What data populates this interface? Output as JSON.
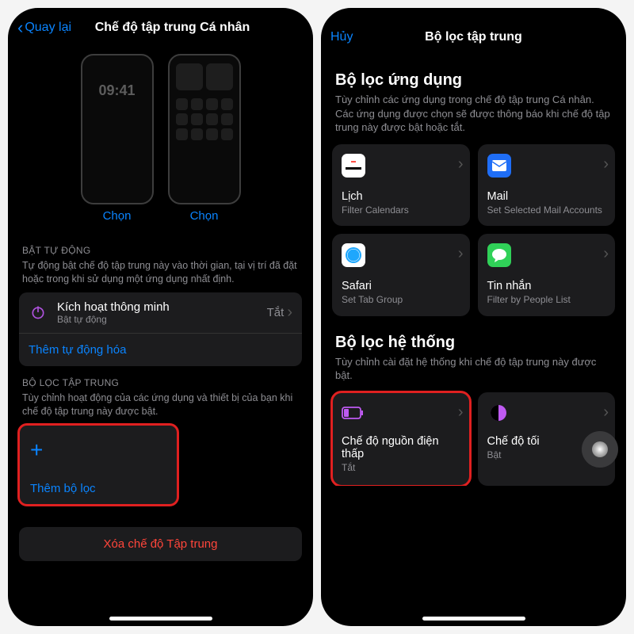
{
  "left": {
    "back": "Quay lại",
    "title": "Chế độ tập trung Cá nhân",
    "lock_time": "09:41",
    "choose": "Chọn",
    "auto_on_header": "BẬT TỰ ĐỘNG",
    "auto_on_desc": "Tự động bật chế độ tập trung này vào thời gian, tại vị trí đã đặt hoặc trong khi sử dụng một ứng dụng nhất định.",
    "smart_row": {
      "title": "Kích hoạt thông minh",
      "sub": "Bật tự động",
      "status": "Tắt"
    },
    "add_automation": "Thêm tự động hóa",
    "filters_header": "BỘ LỌC TẬP TRUNG",
    "filters_desc": "Tùy chỉnh hoạt động của các ứng dụng và thiết bị của bạn khi chế độ tập trung này được bật.",
    "add_filter": "Thêm bộ lọc",
    "delete": "Xóa chế độ Tập trung"
  },
  "right": {
    "cancel": "Hủy",
    "title": "Bộ lọc tập trung",
    "app_section": {
      "title": "Bộ lọc ứng dụng",
      "desc": "Tùy chỉnh các ứng dụng trong chế độ tập trung Cá nhân. Các ứng dụng được chọn sẽ được thông báo khi chế độ tập trung này được bật hoặc tắt."
    },
    "tiles": {
      "calendar": {
        "title": "Lịch",
        "sub": "Filter Calendars"
      },
      "mail": {
        "title": "Mail",
        "sub": "Set Selected Mail Accounts"
      },
      "safari": {
        "title": "Safari",
        "sub": "Set Tab Group"
      },
      "messages": {
        "title": "Tin nhắn",
        "sub": "Filter by People List"
      }
    },
    "sys_section": {
      "title": "Bộ lọc hệ thống",
      "desc": "Tùy chỉnh cài đặt hệ thống khi chế độ tập trung này được bật."
    },
    "sys_tiles": {
      "low_power": {
        "title": "Chế độ nguồn điện thấp",
        "status": "Tắt"
      },
      "dark": {
        "title": "Chế độ tối",
        "status": "Bật"
      }
    }
  }
}
